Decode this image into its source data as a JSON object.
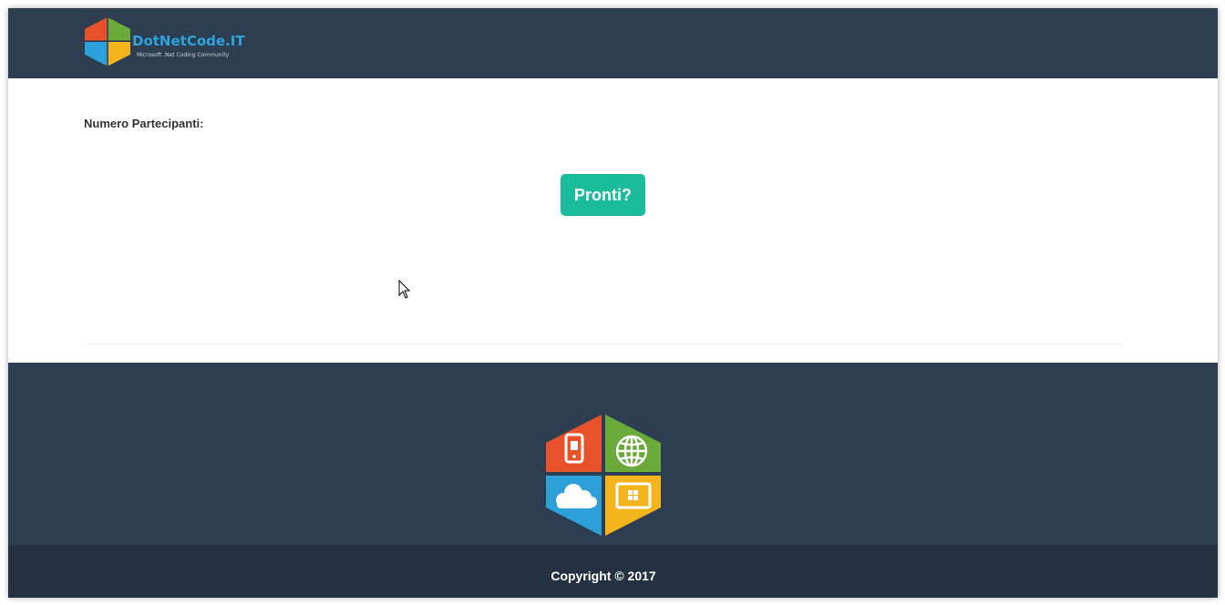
{
  "header": {
    "brand_name": "DotNetCode.IT",
    "brand_tagline": "Microsoft .Net Coding Community"
  },
  "main": {
    "participants_label": "Numero Partecipanti:",
    "start_button_label": "Pronti?"
  },
  "footer": {
    "copyright": "Copyright © 2017"
  },
  "colors": {
    "navbar_bg": "#2d3e50",
    "footer_bottom_bg": "#233140",
    "button_bg": "#1abc9c",
    "logo_orange": "#e8522a",
    "logo_green": "#6aaa3a",
    "logo_blue": "#2d9fd9",
    "logo_yellow": "#f3b51b"
  },
  "icons": [
    "dotnetcode-logo-icon",
    "mobile-phone-icon",
    "globe-icon",
    "cloud-icon",
    "windows-tablet-icon",
    "mouse-cursor-icon"
  ]
}
